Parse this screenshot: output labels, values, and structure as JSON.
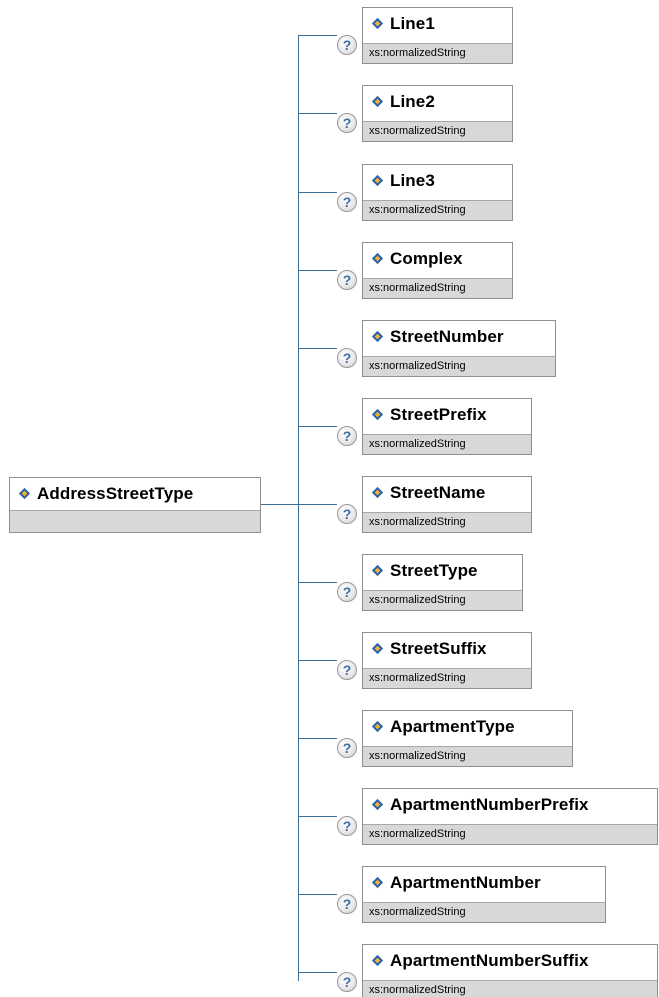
{
  "root": {
    "name": "AddressStreetType"
  },
  "children": [
    {
      "name": "Line1",
      "type": "xs:normalizedString",
      "help": "?"
    },
    {
      "name": "Line2",
      "type": "xs:normalizedString",
      "help": "?"
    },
    {
      "name": "Line3",
      "type": "xs:normalizedString",
      "help": "?"
    },
    {
      "name": "Complex",
      "type": "xs:normalizedString",
      "help": "?"
    },
    {
      "name": "StreetNumber",
      "type": "xs:normalizedString",
      "help": "?"
    },
    {
      "name": "StreetPrefix",
      "type": "xs:normalizedString",
      "help": "?"
    },
    {
      "name": "StreetName",
      "type": "xs:normalizedString",
      "help": "?"
    },
    {
      "name": "StreetType",
      "type": "xs:normalizedString",
      "help": "?"
    },
    {
      "name": "StreetSuffix",
      "type": "xs:normalizedString",
      "help": "?"
    },
    {
      "name": "ApartmentType",
      "type": "xs:normalizedString",
      "help": "?"
    },
    {
      "name": "ApartmentNumberPrefix",
      "type": "xs:normalizedString",
      "help": "?"
    },
    {
      "name": "ApartmentNumber",
      "type": "xs:normalizedString",
      "help": "?"
    },
    {
      "name": "ApartmentNumberSuffix",
      "type": "xs:normalizedString",
      "help": "?"
    }
  ],
  "colors": {
    "connector": "#3c6e96",
    "border": "#8f8f8f",
    "type_band": "#d8d8d8",
    "icon_blue": "#2e5fa8",
    "icon_gold": "#f0b429"
  }
}
